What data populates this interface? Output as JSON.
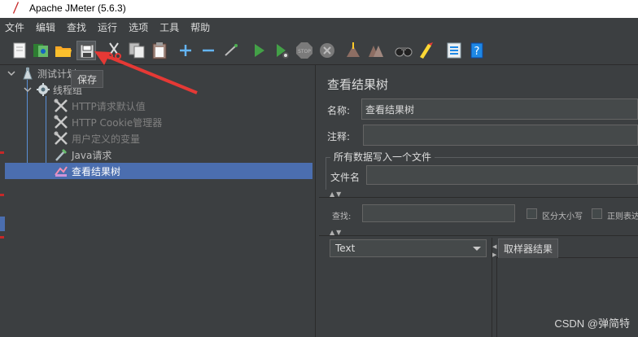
{
  "window": {
    "title": "Apache JMeter (5.6.3)"
  },
  "menu": [
    "文件",
    "编辑",
    "查找",
    "运行",
    "选项",
    "工具",
    "帮助"
  ],
  "toolbar": {
    "icons": [
      "new-icon",
      "templates-icon",
      "open-icon",
      "save-icon",
      "cut-icon",
      "copy-icon",
      "paste-icon",
      "expand-icon",
      "collapse-icon",
      "toggle-icon",
      "start-icon",
      "start-no-pauses-icon",
      "stop-icon",
      "shutdown-icon",
      "clear-icon",
      "clear-all-icon",
      "search-icon",
      "reset-search-icon",
      "function-helper-icon",
      "help-icon"
    ],
    "tooltip": "保存"
  },
  "tree": {
    "items": [
      {
        "label": "测试计划",
        "icon": "test-plan-icon",
        "state": "normal"
      },
      {
        "label": "线程组",
        "icon": "thread-group-icon",
        "state": "normal"
      },
      {
        "label": "HTTP请求默认值",
        "icon": "config-icon",
        "state": "disabled"
      },
      {
        "label": "HTTP Cookie管理器",
        "icon": "config-icon",
        "state": "disabled"
      },
      {
        "label": "用户定义的变量",
        "icon": "config-icon",
        "state": "disabled"
      },
      {
        "label": "Java请求",
        "icon": "sampler-icon",
        "state": "normal"
      },
      {
        "label": "查看结果树",
        "icon": "listener-icon",
        "state": "selected"
      }
    ]
  },
  "panel": {
    "title": "查看结果树",
    "name_label": "名称:",
    "name_value": "查看结果树",
    "comment_label": "注释:",
    "comment_value": "",
    "file_group_title": "所有数据写入一个文件",
    "file_label": "文件名",
    "file_value": "",
    "search_label": "查找:",
    "search_value": "",
    "case_sensitive_label": "区分大小写",
    "regex_label": "正则表达",
    "renderer_selected": "Text",
    "result_tab": "取样器结果"
  },
  "watermark": "CSDN @弹简特",
  "colors": {
    "background": "#3c3f41",
    "selection": "#4b6eaf",
    "annotation": "#e53935"
  }
}
